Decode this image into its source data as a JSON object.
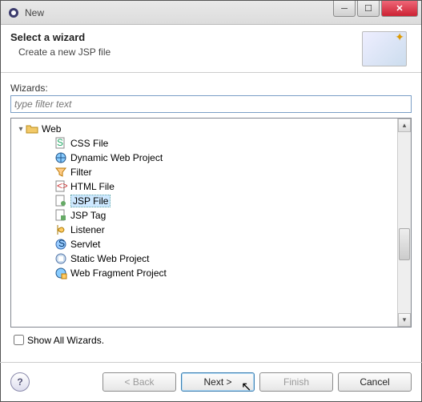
{
  "title": "New",
  "banner": {
    "heading": "Select a wizard",
    "sub": "Create a new JSP file"
  },
  "wizards_label": "Wizards:",
  "filter_placeholder": "type filter text",
  "tree": {
    "parent": "Web",
    "items": [
      {
        "label": "CSS File",
        "icon": "css-file-icon",
        "selected": false
      },
      {
        "label": "Dynamic Web Project",
        "icon": "dyn-web-icon",
        "selected": false
      },
      {
        "label": "Filter",
        "icon": "filter-icon",
        "selected": false
      },
      {
        "label": "HTML File",
        "icon": "html-file-icon",
        "selected": false
      },
      {
        "label": "JSP File",
        "icon": "jsp-file-icon",
        "selected": true
      },
      {
        "label": "JSP Tag",
        "icon": "jsp-tag-icon",
        "selected": false
      },
      {
        "label": "Listener",
        "icon": "listener-icon",
        "selected": false
      },
      {
        "label": "Servlet",
        "icon": "servlet-icon",
        "selected": false
      },
      {
        "label": "Static Web Project",
        "icon": "static-web-icon",
        "selected": false
      },
      {
        "label": "Web Fragment Project",
        "icon": "web-fragment-icon",
        "selected": false
      }
    ]
  },
  "show_all_label": "Show All Wizards.",
  "show_all_checked": false,
  "buttons": {
    "back": "< Back",
    "next": "Next >",
    "finish": "Finish",
    "cancel": "Cancel"
  }
}
